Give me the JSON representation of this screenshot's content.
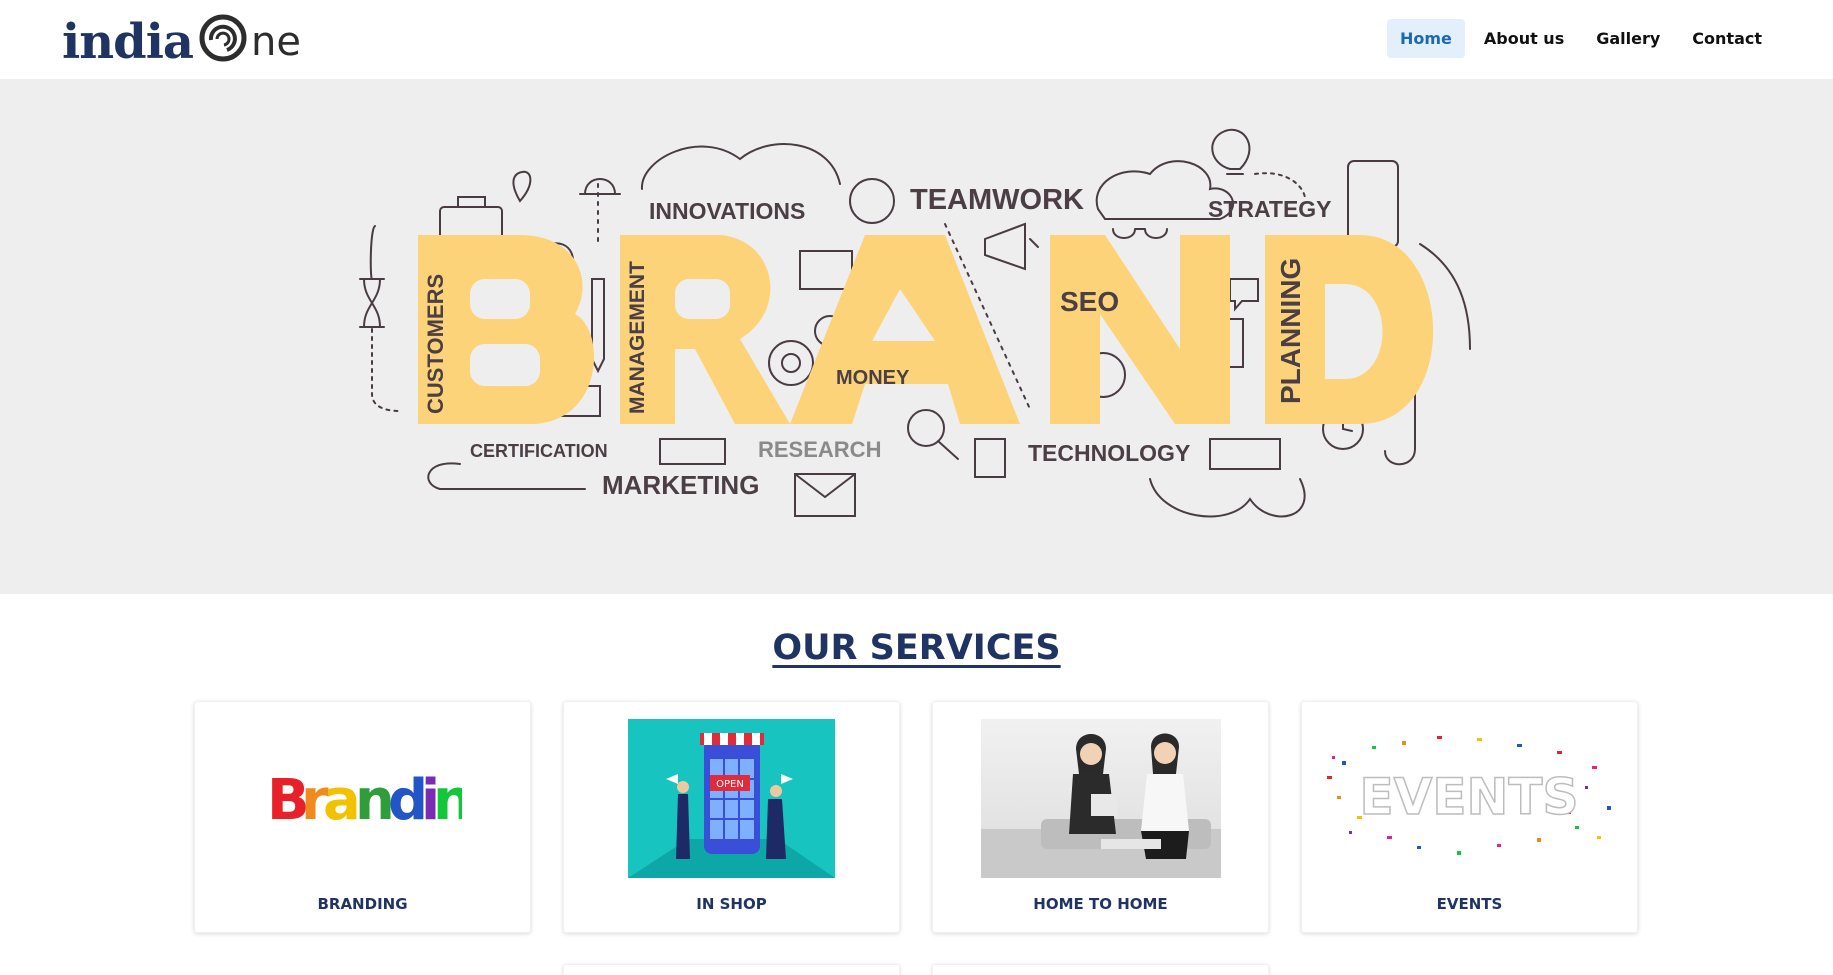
{
  "logo": {
    "part1": "india",
    "part2": "ne"
  },
  "nav": [
    {
      "label": "Home",
      "active": true
    },
    {
      "label": "About us",
      "active": false
    },
    {
      "label": "Gallery",
      "active": false
    },
    {
      "label": "Contact",
      "active": false
    }
  ],
  "hero": {
    "brand_word": "BRAND",
    "words": {
      "innovations": "INNOVATIONS",
      "teamwork": "TEAMWORK",
      "strategy": "STRATEGY",
      "customers": "CUSTOMERS",
      "management": "MANAGEMENT",
      "money": "MONEY",
      "seo": "SEO",
      "planning": "PLANNING",
      "certification": "CERTIFICATION",
      "research": "RESEARCH",
      "marketing": "MARKETING",
      "technology": "TECHNOLOGY"
    }
  },
  "services": {
    "title": "OUR SERVICES",
    "cards": [
      {
        "label": "BRANDING",
        "image_text": "Branding"
      },
      {
        "label": "IN SHOP",
        "image_text": "OPEN"
      },
      {
        "label": "HOME TO HOME",
        "image_text": ""
      },
      {
        "label": "EVENTS",
        "image_text": "EVENTS"
      }
    ]
  },
  "colors": {
    "brand_navy": "#1f3463",
    "nav_active_bg": "#e3f0fb",
    "nav_active_text": "#1a69b5",
    "hero_bg": "#eeeeee",
    "brand_yellow": "#fdd37a",
    "doodle": "#4a3a44"
  }
}
